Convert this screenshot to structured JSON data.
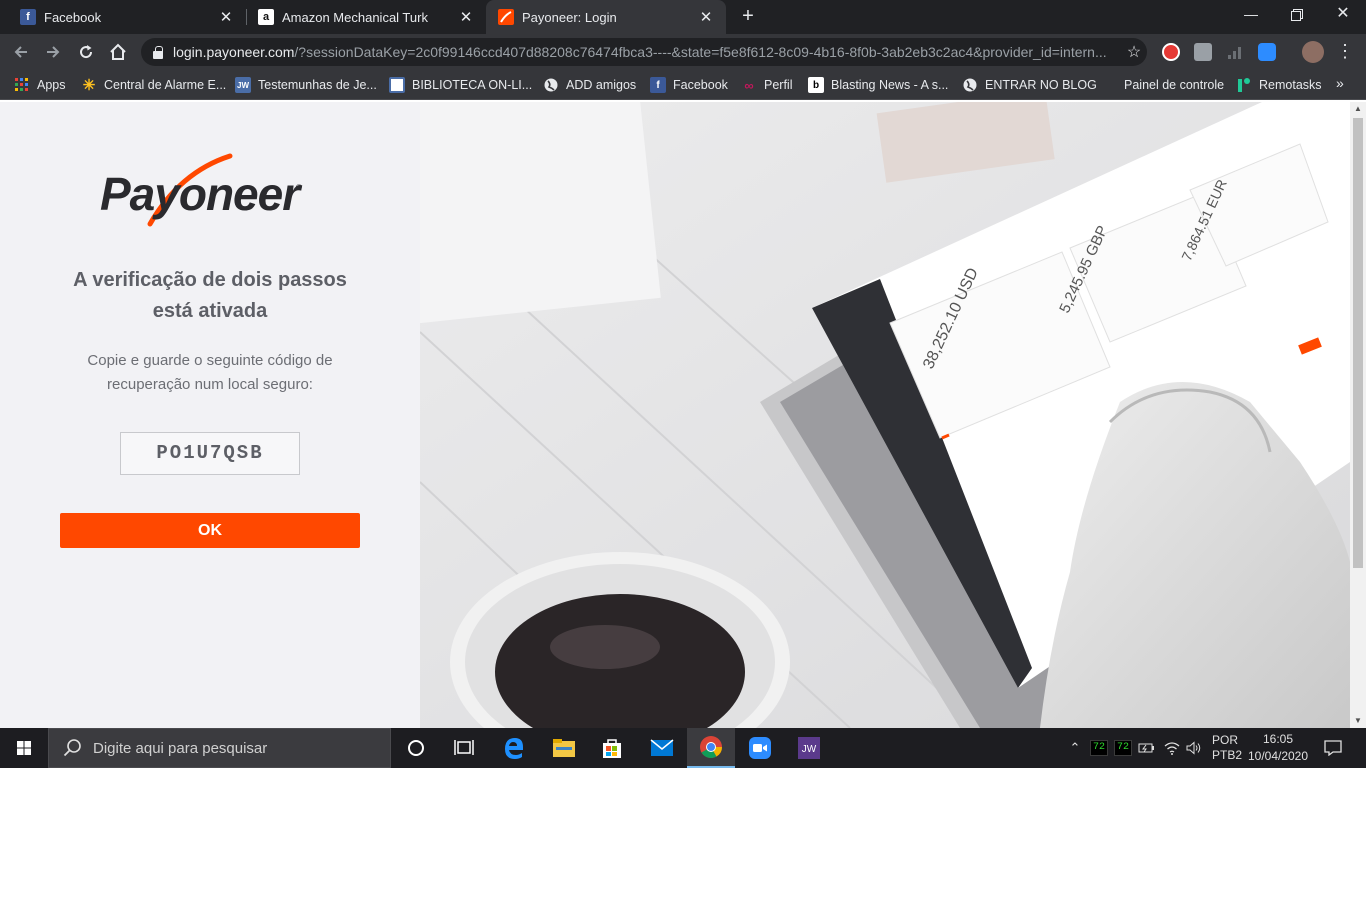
{
  "tabs": [
    {
      "title": "Facebook",
      "favicon": "facebook-icon",
      "active": false
    },
    {
      "title": "Amazon Mechanical Turk",
      "favicon": "amazon-icon",
      "active": false
    },
    {
      "title": "Payoneer: Login",
      "favicon": "payoneer-icon",
      "active": true
    }
  ],
  "address": {
    "host": "login.payoneer.com",
    "path": "/?sessionDataKey=2c0f99146ccd407d88208c76474fbca3----&state=f5e8f612-8c09-4b16-8f0b-3ab2eb3c2ac4&provider_id=intern..."
  },
  "bookmarks": [
    {
      "label": "Apps",
      "icon": "apps-grid-icon"
    },
    {
      "label": "Central de Alarme E...",
      "icon": "walmart-spark-icon"
    },
    {
      "label": "Testemunhas de Je...",
      "icon": "jw-icon"
    },
    {
      "label": "BIBLIOTECA ON-LI...",
      "icon": "library-icon"
    },
    {
      "label": "ADD amigos",
      "icon": "globe-icon"
    },
    {
      "label": "Facebook",
      "icon": "facebook-icon"
    },
    {
      "label": "Perfil",
      "icon": "link-icon"
    },
    {
      "label": "Blasting News - A s...",
      "icon": "blasting-news-icon"
    },
    {
      "label": "ENTRAR NO BLOG",
      "icon": "globe-icon"
    },
    {
      "label": "Painel de controle",
      "icon": ""
    },
    {
      "label": "Remotasks",
      "icon": "remotasks-icon"
    }
  ],
  "bookmarks_more": "»",
  "login": {
    "logo_text": "Payoneer",
    "heading_line1": "A verificação de dois passos",
    "heading_line2": "está ativada",
    "instruction_line1": "Copie e guarde o seguinte código de",
    "instruction_line2": "recuperação num local seguro:",
    "recovery_code": "PO1U7QSB",
    "ok_label": "OK"
  },
  "photo": {
    "amounts": [
      "38,252.10 USD",
      "5,245.95 GBP",
      "7,864.51 EUR"
    ]
  },
  "taskbar": {
    "search_placeholder": "Digite aqui para pesquisar",
    "temp1": "72",
    "temp2": "72",
    "lang_line1": "POR",
    "lang_line2": "PTB2",
    "time": "16:05",
    "date": "10/04/2020"
  },
  "colors": {
    "accent": "#ff4800",
    "chrome_dark": "#202124",
    "chrome_toolbar": "#35363a",
    "panel_bg": "#f2f2f5",
    "taskbar": "#1d1d21"
  }
}
